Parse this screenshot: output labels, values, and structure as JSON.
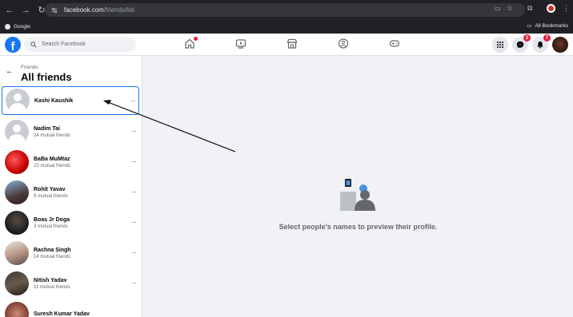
{
  "browser": {
    "url_host": "facebook.com",
    "url_path": "/friends/list",
    "bookmark_google": "Google",
    "bookmark_all": "All Bookmarks"
  },
  "header": {
    "logo": "f",
    "search_placeholder": "Search Facebook",
    "messenger_badge": "2",
    "notifications_badge": "7"
  },
  "sidebar": {
    "breadcrumb": "Friends",
    "title": "All friends",
    "friends": [
      {
        "name": "Kashi Kaushik",
        "mutual": ""
      },
      {
        "name": "Nadim Tai",
        "mutual": "24 mutual friends"
      },
      {
        "name": "BaBa MuMtaz",
        "mutual": "23 mutual friends"
      },
      {
        "name": "Rohit Yavav",
        "mutual": "8 mutual friends"
      },
      {
        "name": "Boas Jr Doga",
        "mutual": "3 mutual friends"
      },
      {
        "name": "Rachna Singh",
        "mutual": "14 mutual friends"
      },
      {
        "name": "Nitish Yadav",
        "mutual": "11 mutual friends"
      },
      {
        "name": "Suresh Kumar Yadav",
        "mutual": ""
      }
    ],
    "more_label": "···"
  },
  "main": {
    "empty_message": "Select people's names to preview their profile."
  },
  "colors": {
    "accent": "#1877f2",
    "badge": "#e41e3f"
  }
}
